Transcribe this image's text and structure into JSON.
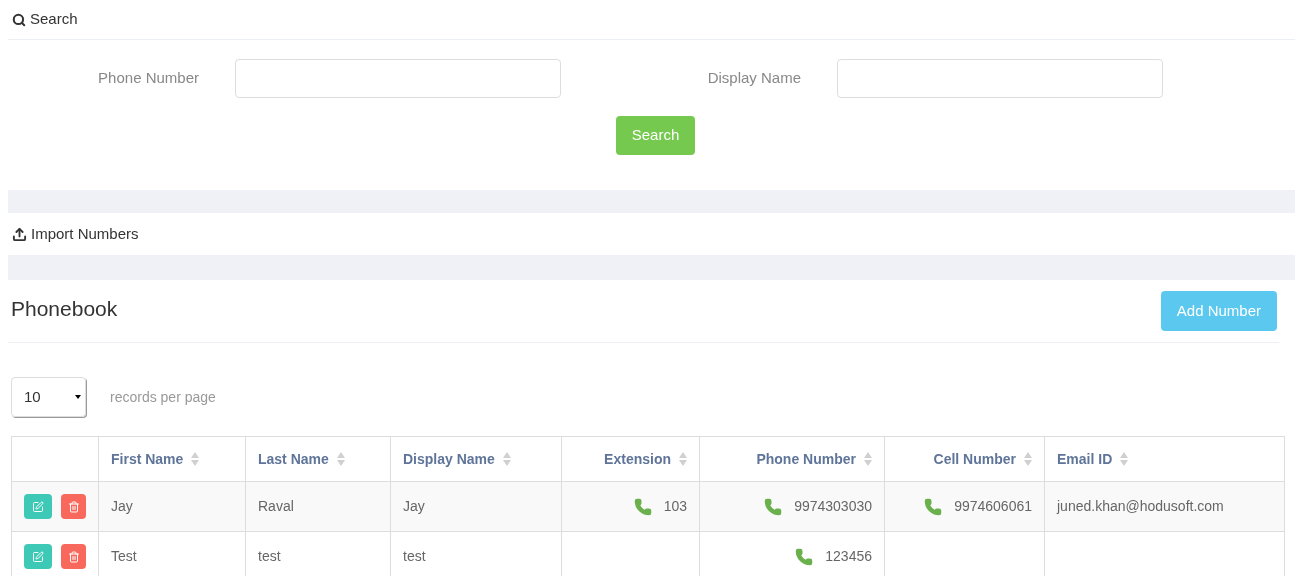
{
  "search_panel": {
    "title": "Search",
    "fields": [
      {
        "label": "Phone Number"
      },
      {
        "label": "Display Name"
      }
    ],
    "button": "Search"
  },
  "import_panel": {
    "title": "Import Numbers"
  },
  "phonebook": {
    "title": "Phonebook",
    "add_button": "Add Number",
    "page_size": "10",
    "page_size_label": "records per page",
    "columns": [
      {
        "label": "First Name"
      },
      {
        "label": "Last Name"
      },
      {
        "label": "Display Name"
      },
      {
        "label": "Extension"
      },
      {
        "label": "Phone Number"
      },
      {
        "label": "Cell Number"
      },
      {
        "label": "Email ID"
      }
    ],
    "rows": [
      {
        "cells": [
          {
            "kind": "text",
            "text": "Jay"
          },
          {
            "kind": "text",
            "text": "Raval"
          },
          {
            "kind": "text",
            "text": "Jay"
          },
          {
            "kind": "phone",
            "text": "103"
          },
          {
            "kind": "phone",
            "text": "9974303030"
          },
          {
            "kind": "phone",
            "text": "9974606061"
          },
          {
            "kind": "text",
            "text": "juned.khan@hodusoft.com"
          }
        ]
      },
      {
        "cells": [
          {
            "kind": "text",
            "text": "Test"
          },
          {
            "kind": "text",
            "text": "test"
          },
          {
            "kind": "text",
            "text": "test"
          },
          {
            "kind": "empty"
          },
          {
            "kind": "phone",
            "text": "123456"
          },
          {
            "kind": "empty"
          },
          {
            "kind": "empty"
          }
        ]
      }
    ]
  }
}
